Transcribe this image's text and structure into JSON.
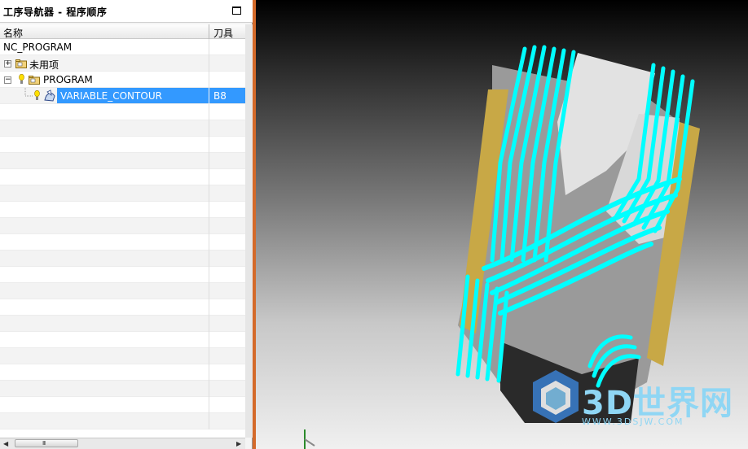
{
  "navigator": {
    "title": "工序导航器 - 程序顺序",
    "columns": {
      "name": "名称",
      "tool": "刀具"
    },
    "rows": [
      {
        "name": "NC_PROGRAM",
        "tool": ""
      },
      {
        "name": "未用项",
        "tool": ""
      },
      {
        "name": "PROGRAM",
        "tool": ""
      },
      {
        "name": "VARIABLE_CONTOUR",
        "tool": "B8",
        "selected": true
      }
    ],
    "scrollbar_grip": "III"
  },
  "watermark": {
    "text": "3D世界网",
    "url": "WWW.3DSJW.COM"
  },
  "colors": {
    "selection": "#3399ff",
    "toolpath": "#00ffff",
    "part_edge": "#c8a846",
    "viewport_border": "#d46a2a"
  },
  "icons": [
    "maximize-icon",
    "expand-plus-icon",
    "collapse-minus-icon",
    "folder-icon",
    "bulb-icon",
    "operation-icon",
    "scroll-left-icon",
    "scroll-right-icon"
  ]
}
